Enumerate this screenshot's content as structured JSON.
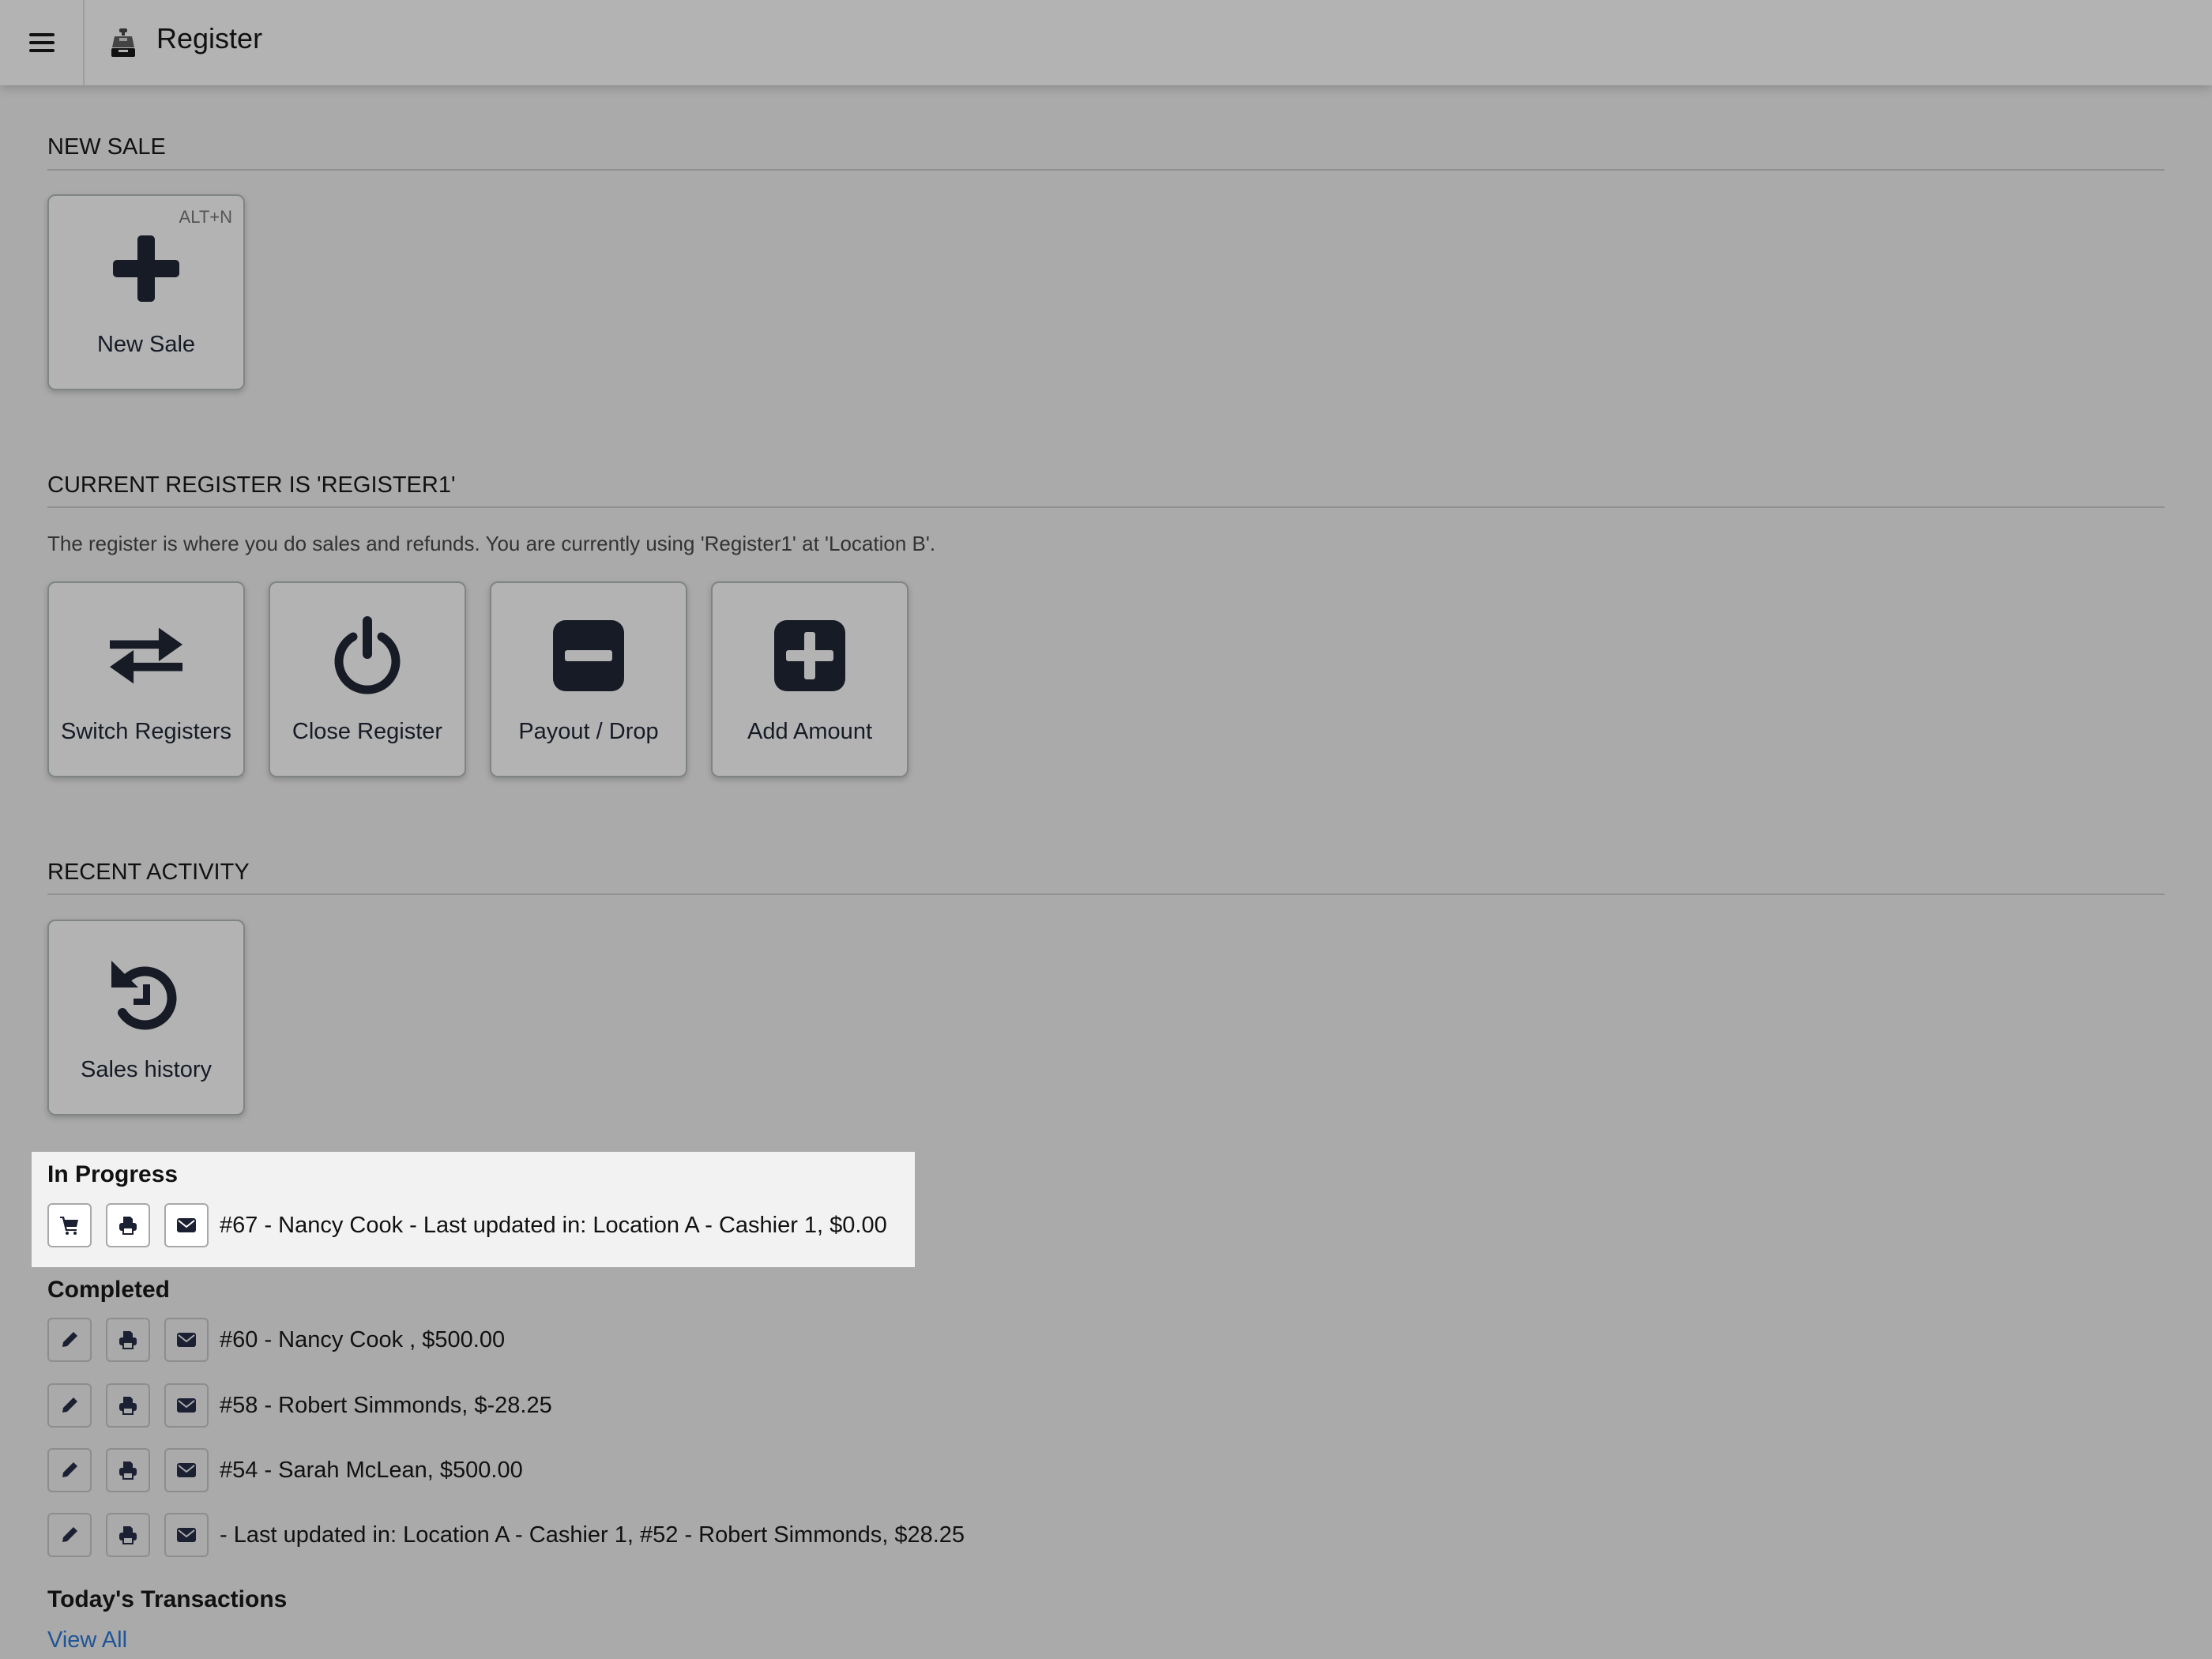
{
  "header": {
    "menu_icon": "hamburger-icon",
    "title_icon": "cash-register-icon",
    "title": "Register"
  },
  "new_sale": {
    "section_title": "NEW SALE",
    "button": {
      "label": "New Sale",
      "shortcut": "ALT+N",
      "icon": "plus-icon"
    }
  },
  "current_register": {
    "section_title": "CURRENT REGISTER IS 'REGISTER1'",
    "description": "The register is where you do sales and refunds. You are currently using 'Register1'  at 'Location B'.",
    "buttons": [
      {
        "label": "Switch Registers",
        "icon": "exchange-arrows-icon"
      },
      {
        "label": "Close Register",
        "icon": "power-icon"
      },
      {
        "label": "Payout / Drop",
        "icon": "minus-square-icon"
      },
      {
        "label": "Add Amount",
        "icon": "plus-square-icon"
      }
    ]
  },
  "recent_activity": {
    "section_title": "RECENT ACTIVITY",
    "sales_history_button": {
      "label": "Sales history",
      "icon": "history-icon"
    },
    "in_progress": {
      "title": "In Progress",
      "items": [
        {
          "text": "#67 - Nancy Cook - Last updated in: Location A - Cashier 1, $0.00",
          "actions": [
            "cart-icon",
            "print-icon",
            "email-icon"
          ]
        }
      ]
    },
    "completed": {
      "title": "Completed",
      "items": [
        {
          "text": "#60 - Nancy Cook , $500.00",
          "actions": [
            "edit-icon",
            "print-icon",
            "email-icon"
          ]
        },
        {
          "text": "#58 - Robert Simmonds, $-28.25",
          "actions": [
            "edit-icon",
            "print-icon",
            "email-icon"
          ]
        },
        {
          "text": "#54 - Sarah McLean, $500.00",
          "actions": [
            "edit-icon",
            "print-icon",
            "email-icon"
          ]
        },
        {
          "text": "- Last updated in: Location A - Cashier 1, #52 - Robert Simmonds, $28.25",
          "actions": [
            "edit-icon",
            "print-icon",
            "email-icon"
          ]
        }
      ]
    },
    "todays_transactions": {
      "title": "Today's Transactions",
      "view_all_label": "View All"
    }
  },
  "colors": {
    "link": "#1f5496",
    "icon_dark": "#161b26",
    "panel_highlight": "#f2f2f2"
  }
}
